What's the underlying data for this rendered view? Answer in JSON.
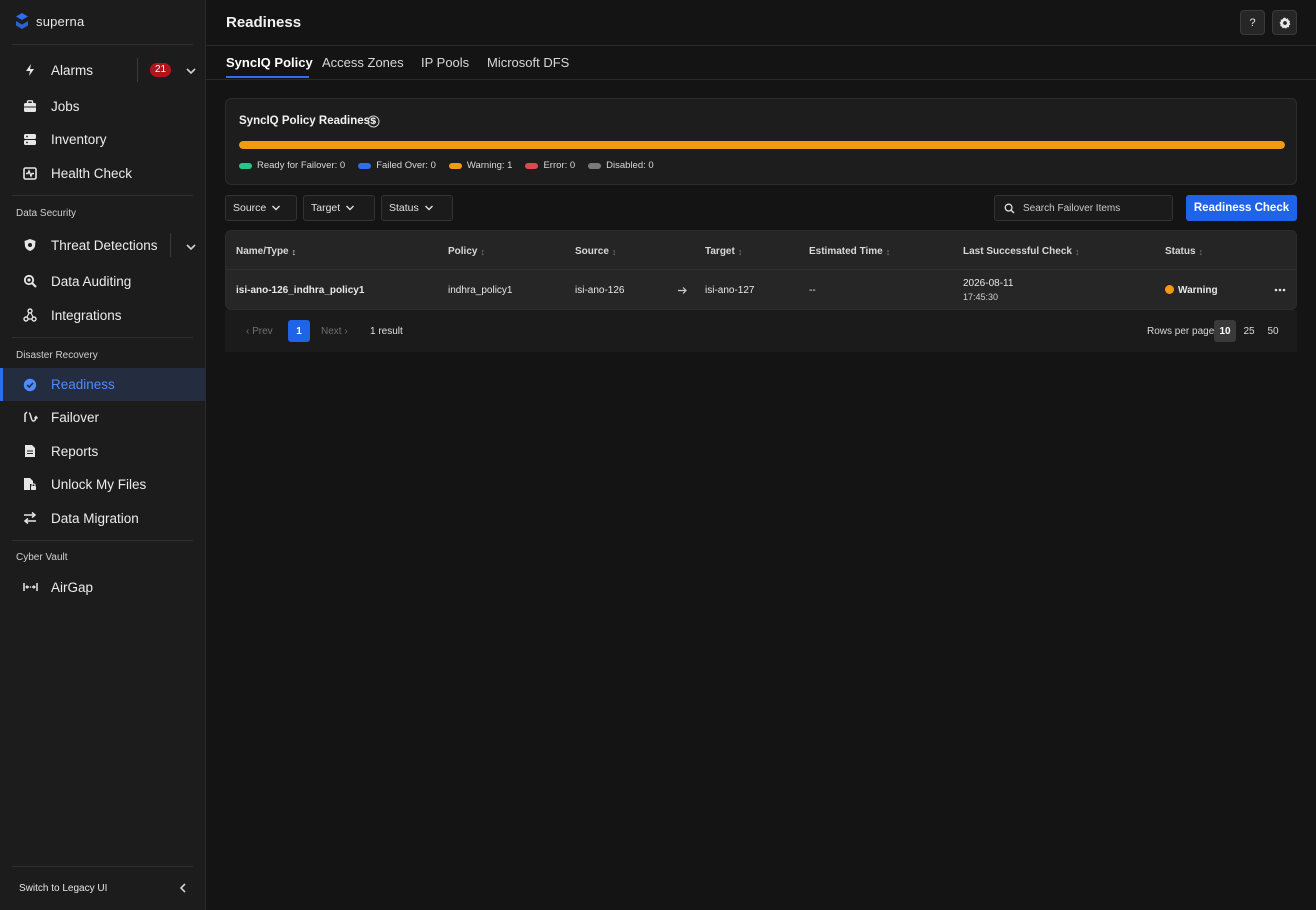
{
  "brand": {
    "name": "superna",
    "color": "#2f6df0"
  },
  "sidebar": {
    "alarms": {
      "label": "Alarms",
      "count": "21",
      "icon": "lightning-icon"
    },
    "items_top": [
      {
        "label": "Jobs",
        "icon": "briefcase-icon"
      },
      {
        "label": "Inventory",
        "icon": "server-icon"
      },
      {
        "label": "Health Check",
        "icon": "heart-monitor-icon"
      }
    ],
    "section_data_security": "Data Security",
    "threat": {
      "label": "Threat Detections",
      "icon": "shield-icon"
    },
    "items_security": [
      {
        "label": "Data Auditing",
        "icon": "magnifier-icon"
      },
      {
        "label": "Integrations",
        "icon": "integrations-icon"
      }
    ],
    "section_disaster_recovery": "Disaster Recovery",
    "items_dr": [
      {
        "label": "Readiness",
        "icon": "check-circle-icon",
        "active": true
      },
      {
        "label": "Failover",
        "icon": "failover-icon"
      },
      {
        "label": "Reports",
        "icon": "document-icon"
      },
      {
        "label": "Unlock My Files",
        "icon": "file-lock-icon"
      },
      {
        "label": "Data Migration",
        "icon": "swap-arrows-icon"
      }
    ],
    "section_cyber_vault": "Cyber Vault",
    "items_vault": [
      {
        "label": "AirGap",
        "icon": "airgap-icon"
      }
    ],
    "legacy_label": "Switch to Legacy UI"
  },
  "header": {
    "title": "Readiness",
    "help_label": "?"
  },
  "tabs": [
    {
      "label": "SyncIQ Policy",
      "active": true
    },
    {
      "label": "Access Zones"
    },
    {
      "label": "IP Pools"
    },
    {
      "label": "Microsoft DFS"
    }
  ],
  "readiness_card": {
    "title": "SyncIQ Policy Readiness",
    "warning_fraction": 1.0,
    "legend": [
      {
        "label": "Ready for Failover: 0",
        "color": "#2bc48a"
      },
      {
        "label": "Failed Over: 0",
        "color": "#2f6df0"
      },
      {
        "label": "Warning: 1",
        "color": "#f29a13"
      },
      {
        "label": "Error: 0",
        "color": "#e0484e"
      },
      {
        "label": "Disabled: 0",
        "color": "#7a7a7a"
      }
    ]
  },
  "filters": {
    "source": "Source",
    "target": "Target",
    "status": "Status"
  },
  "search": {
    "placeholder": "Search Failover Items"
  },
  "readiness_check_label": "Readiness Check",
  "table": {
    "columns": {
      "name": "Name/Type",
      "policy": "Policy",
      "source": "Source",
      "target": "Target",
      "estimated": "Estimated Time",
      "last_check": "Last Successful Check",
      "status": "Status"
    },
    "rows": [
      {
        "name": "isi-ano-126_indhra_policy1",
        "policy": "indhra_policy1",
        "source": "isi-ano-126",
        "target": "isi-ano-127",
        "estimated": "--",
        "last_date": "2026-08-11",
        "last_time": "17:45:30",
        "status": "Warning"
      }
    ]
  },
  "pager": {
    "prev": "Prev",
    "next": "Next",
    "page": "1",
    "count": "1 result",
    "rows_per_page_label": "Rows per page",
    "options": [
      "10",
      "25",
      "50"
    ]
  }
}
